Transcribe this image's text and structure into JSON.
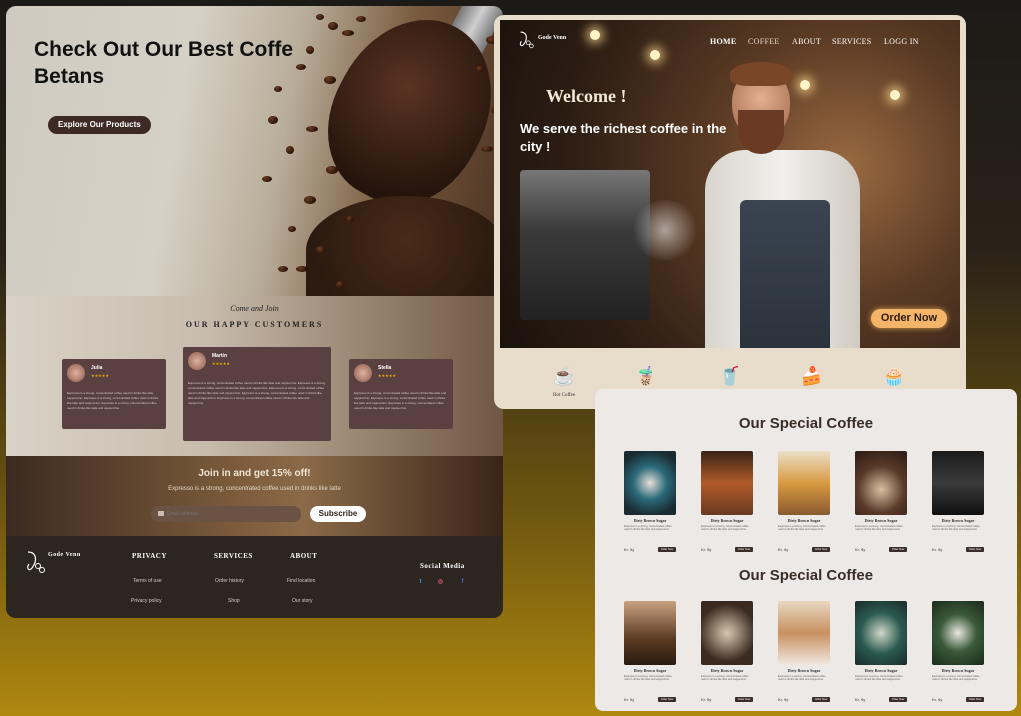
{
  "landing": {
    "hero": {
      "title": "Check Out Our  Best Coffe Betans",
      "button": "Explore Our  Products"
    },
    "customers": {
      "script": "Come and Join",
      "title": "OUR HAPPY CUSTOMERS",
      "reviews": [
        {
          "name": "Julia",
          "stars": "★★★★★",
          "text": "Espresso is a strong, concentrated coffee used in drinks like latte cappuccino. Espresso is a strong, concentrated coffee used in drinks like latte and cappuccino. Espresso is a strong, concentrated coffee used in drinks like latte and cappuccino."
        },
        {
          "name": "Martin",
          "stars": "★★★★★",
          "text": "Espresso is a strong, concentrated coffee used in drinks like latte and cappuccino. Espresso is a strong, concentrated coffee used in drinks like latte and cappuccino. Espresso is a strong, concentrated coffee used in drinks like latte and cappuccino. Espresso is a strong, concentrated coffee used in drinks like latte and cappuccino. Espresso is a strong, concentrated coffee used in drinks like latte and cappuccino."
        },
        {
          "name": "Stella",
          "stars": "★★★★★",
          "text": "Espresso is a strong, concentrated coffee used in drinks like latte and cappuccino. Espresso is a strong, concentrated coffee used in drinks like latte and cappuccino. Espresso is a strong, concentrated coffee used in drinks like latte and cappuccino."
        }
      ]
    },
    "join": {
      "title": "Join in and get 15% off!",
      "subtitle": "Expresso is a strong, concentrated coffee used in drinks like latte",
      "email_placeholder": "Email address",
      "button": "Subscribe"
    },
    "footer": {
      "brand": "Gode Venn",
      "privacy": {
        "heading": "PRIVACY",
        "links": [
          "Terms of use",
          "Privacy policy"
        ]
      },
      "services": {
        "heading": "SERVICES",
        "links": [
          "Order history",
          "Shop"
        ]
      },
      "about": {
        "heading": "ABOUT",
        "links": [
          "Find location",
          "Our story"
        ]
      },
      "social": {
        "heading": "Social Media",
        "icons": [
          "twitter-icon",
          "instagram-icon",
          "facebook-icon"
        ],
        "glyphs": {
          "twitter": "t",
          "instagram": "◎",
          "facebook": "f"
        }
      }
    }
  },
  "home": {
    "brand": "Gode Venn",
    "nav": [
      "HOME",
      "COFFEE",
      "ABOUT",
      "SERVICES",
      "LOGG IN"
    ],
    "welcome": "Welcome !",
    "tagline": "We serve the richest coffee in the city !",
    "order_button": "Order Now",
    "categories": [
      {
        "label": "Hot Coffee",
        "icon": "hot-coffee-icon",
        "glyph": "☕"
      },
      {
        "label": "Boba Tea",
        "icon": "boba-tea-icon",
        "glyph": "🧋"
      },
      {
        "label": "Cold Coffee",
        "icon": "cold-coffee-icon",
        "glyph": "🥤"
      },
      {
        "label": "Cakes",
        "icon": "cake-icon",
        "glyph": "🍰"
      },
      {
        "label": "Dessert",
        "icon": "dessert-icon",
        "glyph": "🧁"
      }
    ]
  },
  "products": {
    "sections": [
      {
        "title": "Our Special Coffee"
      },
      {
        "title": "Our Special Coffee"
      }
    ],
    "item": {
      "name": "Dirty Brown Sugar",
      "desc": "Espresso is a strong, concentrated coffee used in drinks like latte and cappuccino.",
      "price": "Kr. 9y",
      "button": "Order Now"
    }
  },
  "colors": {
    "accent": "#f4b56a",
    "dark": "#3a2c28",
    "brown": "#5a4040"
  }
}
